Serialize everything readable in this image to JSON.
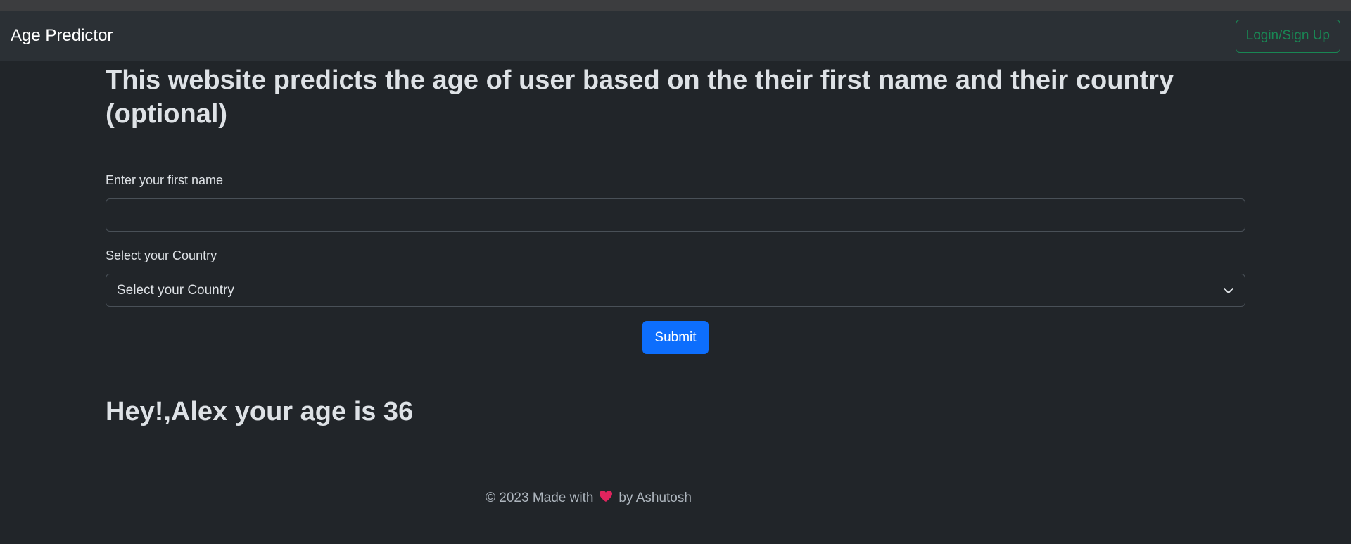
{
  "navbar": {
    "brand": "Age Predictor",
    "login_label": "Login/Sign Up"
  },
  "main": {
    "headline": "This website predicts the age of user based on the their first name and their country (optional)",
    "name_field": {
      "label": "Enter your first name",
      "value": "",
      "placeholder": ""
    },
    "country_field": {
      "label": "Select your Country",
      "selected": "Select your Country"
    },
    "submit_label": "Submit",
    "result": "Hey!,Alex your age is 36"
  },
  "footer": {
    "prefix": "© 2023 Made with",
    "suffix": "by Ashutosh",
    "heart_icon": "heart-icon",
    "heart_color": "#e0245e"
  },
  "colors": {
    "background": "#212529",
    "navbar": "#2b3035",
    "success": "#198754",
    "primary": "#0d6efd"
  }
}
